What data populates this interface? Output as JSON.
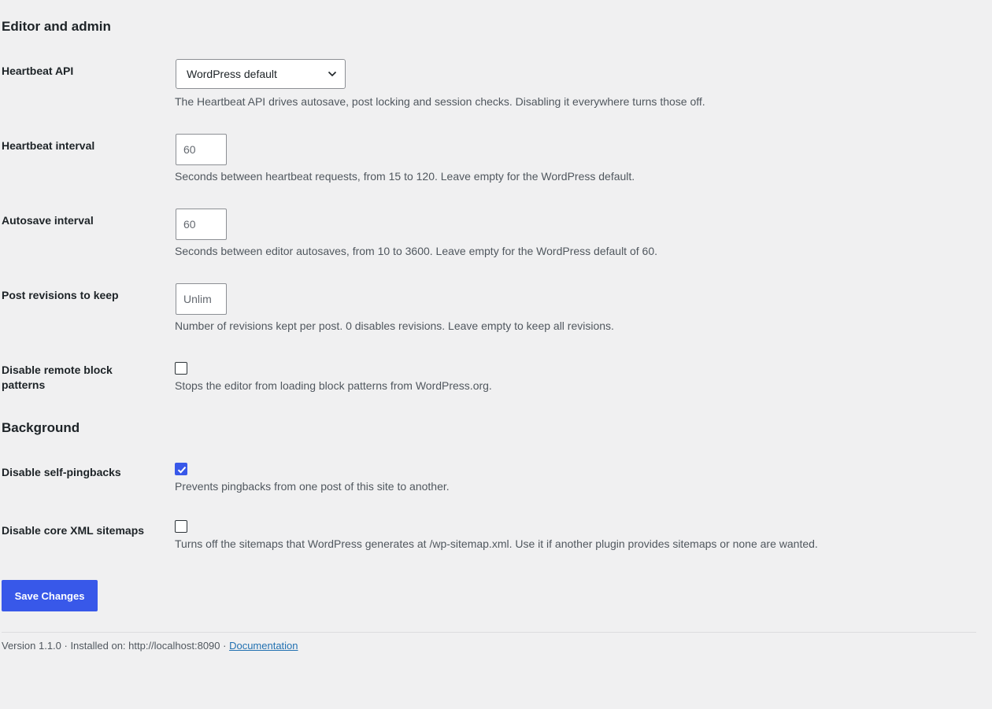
{
  "sections": {
    "editor_admin_title": "Editor and admin",
    "background_title": "Background"
  },
  "heartbeat_api": {
    "label": "Heartbeat API",
    "selected": "WordPress default",
    "description": "The Heartbeat API drives autosave, post locking and session checks. Disabling it everywhere turns those off."
  },
  "heartbeat_interval": {
    "label": "Heartbeat interval",
    "placeholder": "60",
    "description": "Seconds between heartbeat requests, from 15 to 120. Leave empty for the WordPress default."
  },
  "autosave_interval": {
    "label": "Autosave interval",
    "placeholder": "60",
    "description": "Seconds between editor autosaves, from 10 to 3600. Leave empty for the WordPress default of 60."
  },
  "post_revisions": {
    "label": "Post revisions to keep",
    "placeholder": "Unlim",
    "description": "Number of revisions kept per post. 0 disables revisions. Leave empty to keep all revisions."
  },
  "remote_block_patterns": {
    "label": "Disable remote block patterns",
    "checked": false,
    "description": "Stops the editor from loading block patterns from WordPress.org."
  },
  "self_pingbacks": {
    "label": "Disable self-pingbacks",
    "checked": true,
    "description": "Prevents pingbacks from one post of this site to another."
  },
  "xml_sitemaps": {
    "label": "Disable core XML sitemaps",
    "checked": false,
    "description": "Turns off the sitemaps that WordPress generates at /wp-sitemap.xml. Use it if another plugin provides sitemaps or none are wanted."
  },
  "save_button": "Save Changes",
  "footer": {
    "text": "Version 1.1.0 · Installed on: http://localhost:8090 · ",
    "link": "Documentation"
  },
  "icons": {
    "select": "chevron-down-icon",
    "checked": "checkmark-icon"
  },
  "colors": {
    "accent": "#3858e9",
    "background": "#f0f0f1",
    "text": "#1d2327",
    "muted_text": "#50575e",
    "link": "#2271b1"
  }
}
